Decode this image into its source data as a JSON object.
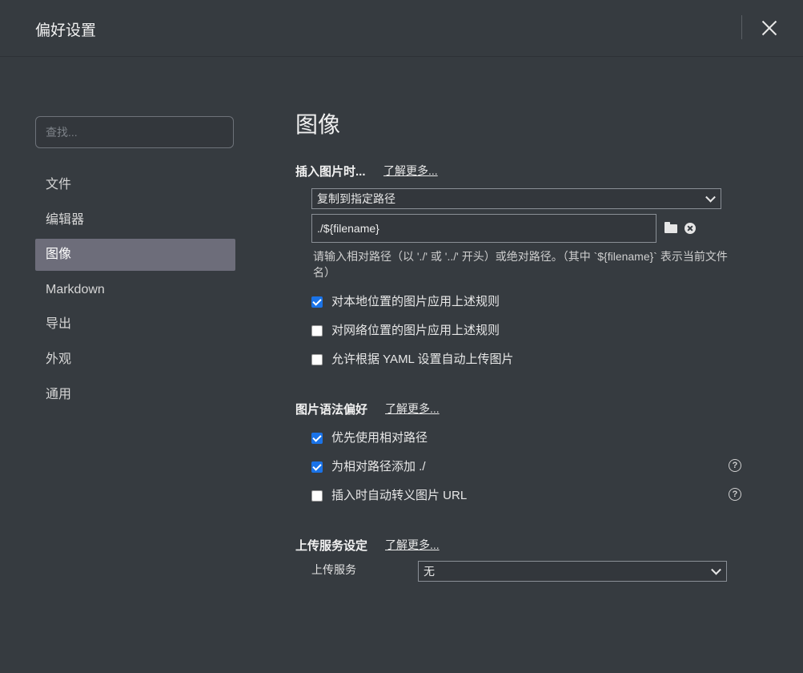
{
  "window": {
    "title": "偏好设置"
  },
  "sidebar": {
    "search_placeholder": "查找...",
    "items": [
      {
        "label": "文件"
      },
      {
        "label": "编辑器"
      },
      {
        "label": "图像",
        "active": true
      },
      {
        "label": "Markdown"
      },
      {
        "label": "导出"
      },
      {
        "label": "外观"
      },
      {
        "label": "通用"
      }
    ]
  },
  "main": {
    "heading": "图像",
    "insert": {
      "title": "插入图片时...",
      "learn_more": "了解更多...",
      "action_selected": "复制到指定路径",
      "path_value": "./${filename}",
      "hint": "请输入相对路径（以 './' 或 '../' 开头）或绝对路径。（其中 `${filename}` 表示当前文件名）",
      "checks": [
        {
          "label": "对本地位置的图片应用上述规则",
          "checked": true
        },
        {
          "label": "对网络位置的图片应用上述规则",
          "checked": false
        },
        {
          "label": "允许根据 YAML 设置自动上传图片",
          "checked": false
        }
      ]
    },
    "syntax": {
      "title": "图片语法偏好",
      "learn_more": "了解更多...",
      "checks": [
        {
          "label": "优先使用相对路径",
          "checked": true
        },
        {
          "label": "为相对路径添加 ./",
          "checked": true,
          "help": true
        },
        {
          "label": "插入时自动转义图片 URL",
          "checked": false,
          "help": true
        }
      ]
    },
    "upload": {
      "title": "上传服务设定",
      "learn_more": "了解更多...",
      "service_label": "上传服务",
      "service_selected": "无"
    }
  },
  "icons": {
    "close": "close-icon",
    "folder": "folder-icon",
    "clear": "clear-circle-icon",
    "help": "question-circle-icon",
    "checked_color": "#1a73e8"
  }
}
